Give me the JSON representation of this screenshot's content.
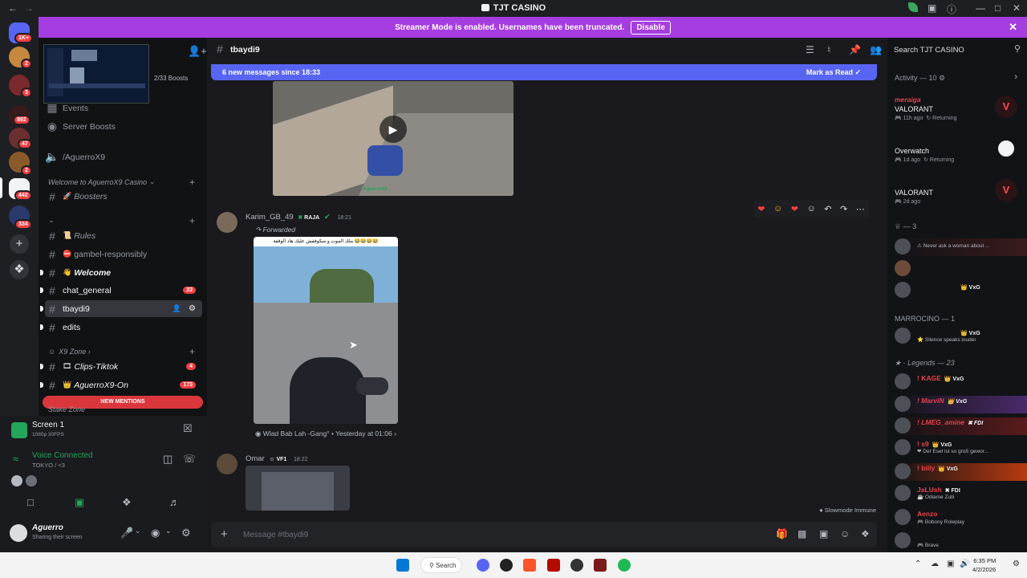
{
  "window": {
    "title": "TJT CASINO",
    "back_icon": "arrow-left",
    "forward_icon": "arrow-right"
  },
  "banner": {
    "text": "Streamer Mode is enabled. Usernames have been truncated.",
    "button": "Disable"
  },
  "server_rail": {
    "badges": [
      "1K+",
      "2",
      "3",
      "892",
      "47",
      "2",
      "442",
      "334"
    ]
  },
  "sidebar": {
    "boosts": "2/33 Boosts",
    "items": [
      {
        "label": "Events"
      },
      {
        "label": "Server Boosts"
      },
      {
        "label": "/AguerroX9"
      }
    ],
    "categories": [
      {
        "label": "Welcome to AguerroX9 Casino"
      },
      {
        "label": "X9 Zone"
      }
    ],
    "channels": [
      {
        "label": "Boosters"
      },
      {
        "label": "Rules"
      },
      {
        "label": "gambel-responsibly"
      },
      {
        "label": "Welcome"
      },
      {
        "label": "chat_general",
        "count": "23"
      },
      {
        "label": "tbaydi9"
      },
      {
        "label": "edits"
      },
      {
        "label": "Clips-Tiktok",
        "count": "4"
      },
      {
        "label": "AguerroX9-On",
        "count": "173"
      }
    ],
    "new_mentions": "NEW MENTIONS",
    "stake_zone": "Stake Zone"
  },
  "panel": {
    "screen_title": "Screen 1",
    "screen_sub": "1080p 30FPS",
    "voice": "Voice Connected",
    "voice_sub": "TOKYO / <3",
    "username": "Aguerro",
    "user_status": "Sharing their screen"
  },
  "main": {
    "channel": "tbaydi9",
    "new_messages": "6 new messages since 18:33",
    "mark_read": "Mark as Read",
    "video_hud": "AguerroX9",
    "msg1": {
      "author": "Karim_GB_49",
      "tag": "RAJA",
      "time": "18:21",
      "forwarded": "Forwarded",
      "caption": "ملك الموت و ميكوفقش عليك هاد الوقفة 😂😂😂😂",
      "source": "Wlad Bab Lah -Gang°",
      "source_time": "Yesterday at 01:06"
    },
    "msg2": {
      "author": "Omar",
      "tag": "VF1",
      "time": "18:22"
    },
    "slowmode": "Slowmode Immune",
    "composer_placeholder": "Message #tbaydi9"
  },
  "members": {
    "search_placeholder": "Search TJT CASINO",
    "activity_header": "Activity — 10",
    "activities": [
      {
        "user": "meraiga",
        "game": "VALORANT",
        "meta": "11h ago",
        "status": "Returning",
        "color": "#e8434b"
      },
      {
        "user": "",
        "game": "Overwatch",
        "meta": "1d ago",
        "status": "Returning",
        "color": "#e8434b"
      },
      {
        "user": "",
        "game": "VALORANT",
        "meta": "2d ago",
        "status": "",
        "color": "#e8434b"
      }
    ],
    "section_3": "3",
    "group3": [
      {
        "name": "",
        "status": "Never ask a woman about ..."
      },
      {
        "name": "",
        "status": ""
      },
      {
        "name": "",
        "tag": "VxG"
      }
    ],
    "section_marrocino": "MARROCINO — 1",
    "marrocino": [
      {
        "name": "",
        "tag": "VxG",
        "status": "Silence speaks louder"
      }
    ],
    "section_legends": "Legends — 23",
    "legends": [
      {
        "name": "! KAGE",
        "tag": "VxG",
        "status": "",
        "color": "#e8434b"
      },
      {
        "name": "! MarviN",
        "tag": "VxG",
        "status": "",
        "color": "#e8434b"
      },
      {
        "name": "! LMEG_amine",
        "tag": "FDI",
        "status": "",
        "color": "#e8434b"
      },
      {
        "name": "! s9",
        "tag": "VxG",
        "status": "Der Esel ist so groß gewor...",
        "color": "#e8434b"
      },
      {
        "name": "! billy",
        "tag": "VxG",
        "status": "",
        "color": "#e8434b"
      },
      {
        "name": "JaLUsh",
        "tag": "FDI",
        "status": "Odiame Zulli",
        "color": "#e8434b"
      },
      {
        "name": "Aenzo",
        "tag": "",
        "status": "Bobony Roleplay",
        "color": "#e8434b"
      },
      {
        "name": "",
        "tag": "",
        "status": "Brave",
        "color": "#e8434b"
      }
    ]
  },
  "taskbar": {
    "search": "Search",
    "time": "6:35 PM",
    "date": "4/2/2026"
  }
}
